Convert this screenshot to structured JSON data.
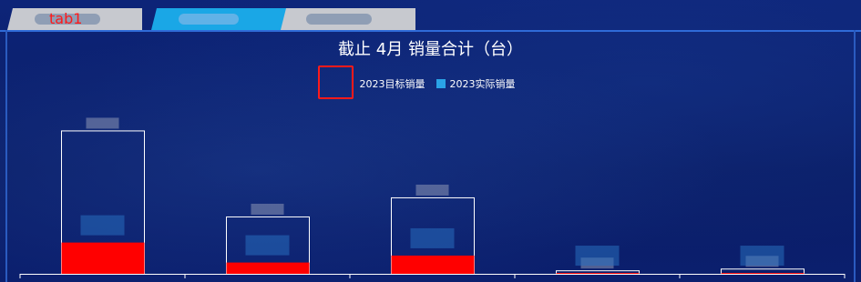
{
  "tabs": [
    {
      "label": "tab1",
      "active": false
    },
    {
      "label": "",
      "active": true
    },
    {
      "label": "",
      "active": false
    }
  ],
  "colors": {
    "target": "#ffffff",
    "actual": "#ff0000",
    "legend_actual": "#2aa3e6",
    "tab_active": "#1aa7e6",
    "tab_inactive": "#c7c9cf",
    "background": "#0b1f6b"
  },
  "chart_data": {
    "type": "bar",
    "title": "截止 4月 销量合计（台）",
    "legend": [
      "2023目标销量",
      "2023实际销量"
    ],
    "categories": [
      "",
      "",
      "",
      "",
      ""
    ],
    "series": [
      {
        "name": "2023目标销量",
        "values": [
          165,
          66,
          88,
          4,
          6
        ]
      },
      {
        "name": "2023实际销量",
        "values": [
          36,
          13,
          21,
          1,
          1
        ]
      }
    ],
    "ylim": [
      0,
      200
    ],
    "grid": false
  }
}
